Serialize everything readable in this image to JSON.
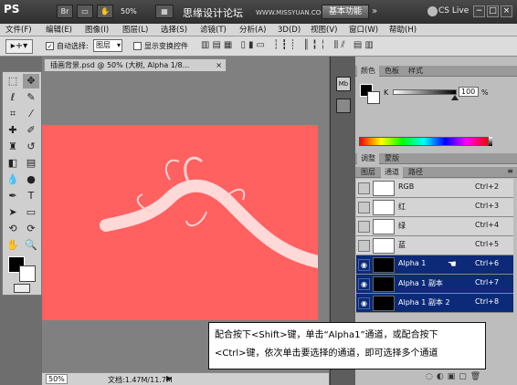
{
  "titlebar": {
    "logo": "PS",
    "zoom": "50%",
    "watermark": "思缘设计论坛",
    "watermark_url": "WWW.MISSYUAN.COM",
    "workspace": "基本功能",
    "cslive": "CS Live"
  },
  "menu": [
    "文件(F)",
    "编辑(E)",
    "图像(I)",
    "图层(L)",
    "选择(S)",
    "滤镜(T)",
    "分析(A)",
    "3D(D)",
    "视图(V)",
    "窗口(W)",
    "帮助(H)"
  ],
  "options": {
    "auto_select_label": "自动选择:",
    "auto_select_value": "图层",
    "show_transform_label": "显示变换控件"
  },
  "document": {
    "tab_title": "插画背景.psd @ 50% (大树, Alpha 1/8...",
    "zoom": "50%",
    "doc_info": "文档:1.47M/11.7M"
  },
  "color_panel": {
    "tabs": [
      "颜色",
      "色板",
      "样式"
    ],
    "k_label": "K",
    "k_value": "100",
    "unit": "%"
  },
  "adjust_tabs": [
    "调整",
    "蒙版"
  ],
  "layer_tabs": [
    "图层",
    "通道",
    "路径"
  ],
  "channels": [
    {
      "name": "RGB",
      "shortcut": "Ctrl+2",
      "selected": false
    },
    {
      "name": "红",
      "shortcut": "Ctrl+3",
      "selected": false
    },
    {
      "name": "绿",
      "shortcut": "Ctrl+4",
      "selected": false
    },
    {
      "name": "蓝",
      "shortcut": "Ctrl+5",
      "selected": false
    },
    {
      "name": "Alpha 1",
      "shortcut": "Ctrl+6",
      "selected": true
    },
    {
      "name": "Alpha 1 副本",
      "shortcut": "Ctrl+7",
      "selected": true
    },
    {
      "name": "Alpha 1 副本 2",
      "shortcut": "Ctrl+8",
      "selected": true
    }
  ],
  "caption": {
    "line1": "配合按下<Shift>键，单击“Alpha1”通道，或配合按下",
    "line2": "<Ctrl>键，依次单击要选择的通道，即可选择多个通道"
  },
  "colors": {
    "canvas": "#ff6060",
    "selection": "#0c2a78"
  }
}
